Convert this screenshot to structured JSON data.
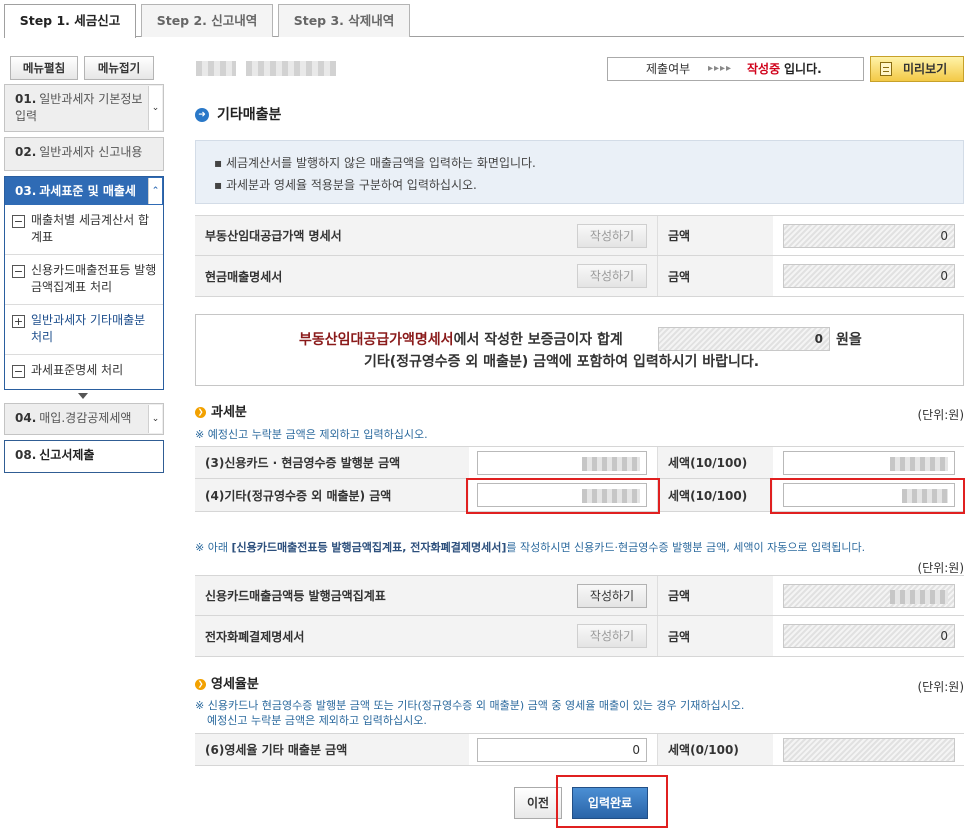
{
  "tabs": [
    "Step 1. 세금신고",
    "Step 2. 신고내역",
    "Step 3. 삭제내역"
  ],
  "left_nav": {
    "expand_label": "메뉴펼침",
    "collapse_label": "메뉴접기",
    "items": [
      {
        "num": "01.",
        "label": "일반과세자 기본정보 입력"
      },
      {
        "num": "02.",
        "label": "일반과세자 신고내용"
      },
      {
        "num": "03.",
        "label": "과세표준 및 매출세"
      },
      {
        "num": "04.",
        "label": "매입.경감공제세액"
      },
      {
        "num": "08.",
        "label": "신고서제출"
      }
    ],
    "sub_items": [
      {
        "box": "−",
        "label": "매출처별 세금계산서 합계표"
      },
      {
        "box": "−",
        "label": "신용카드매출전표등 발행금액집계표 처리"
      },
      {
        "box": "+",
        "label": "일반과세자 기타매출분 처리"
      },
      {
        "box": "−",
        "label": "과세표준명세 처리"
      }
    ]
  },
  "status": {
    "label": "제출여부",
    "arrows": "▸▸▸▸",
    "value_red": "작성중",
    "value_suffix": "입니다."
  },
  "preview_label": "미리보기",
  "section_title": "기타매출분",
  "info_lines": [
    "▪ 세금계산서를 발행하지 않은 매출금액을 입력하는 화면입니다.",
    "▪ 과세분과 영세율 적용분을 구분하여 입력하십시오."
  ],
  "top_rows": [
    {
      "label": "부동산임대공급가액 명세서",
      "button": "작성하기",
      "amount_label": "금액",
      "amount": "0"
    },
    {
      "label": "현금매출명세서",
      "button": "작성하기",
      "amount_label": "금액",
      "amount": "0"
    }
  ],
  "notice": {
    "link": "부동산임대공급가액명세서",
    "text1": "에서 작성한 보증금이자 합계",
    "value": "0",
    "unit": "원을",
    "line2": "기타(정규영수증 외 매출분) 금액에 포함하여 입력하시기 바랍니다."
  },
  "taxable": {
    "title": "과세분",
    "unit": "(단위:원)",
    "note": "※ 예정신고 누락분 금액은 제외하고 입력하십시오.",
    "rows": [
      {
        "label": "(3)신용카드 · 현금영수증 발행분 금액",
        "tax_label": "세액(10/100)"
      },
      {
        "label": "(4)기타(정규영수증 외 매출분) 금액",
        "tax_label": "세액(10/100)"
      }
    ]
  },
  "auto_note": {
    "prefix": "※ 아래 ",
    "bold": "[신용카드매출전표등 발행금액집계표, 전자화폐결제명세서]",
    "suffix": "를 작성하시면 신용카드·현금영수증 발행분 금액, 세액이 자동으로 입력됩니다."
  },
  "auto_unit": "(단위:원)",
  "auto_rows": [
    {
      "label": "신용카드매출금액등 발행금액집계표",
      "button": "작성하기",
      "amount_label": "금액"
    },
    {
      "label": "전자화폐결제명세서",
      "button": "작성하기",
      "amount_label": "금액",
      "amount": "0"
    }
  ],
  "zero_rate": {
    "title": "영세율분",
    "unit": "(단위:원)",
    "note1": "※ 신용카드나 현금영수증 발행분 금액 또는 기타(정규영수증 외 매출분) 금액 중 영세율 매출이 있는 경우 기재하십시오.",
    "note2": "예정신고 누락분 금액은 제외하고 입력하십시오.",
    "row": {
      "label": "(6)영세율 기타 매출분 금액",
      "value": "0",
      "tax_label": "세액(0/100)"
    }
  },
  "buttons": {
    "prev": "이전",
    "done": "입력완료"
  },
  "colors": {
    "accent_blue": "#2f6bb5",
    "status_red": "#d0021b",
    "highlight_red": "#e02020"
  }
}
